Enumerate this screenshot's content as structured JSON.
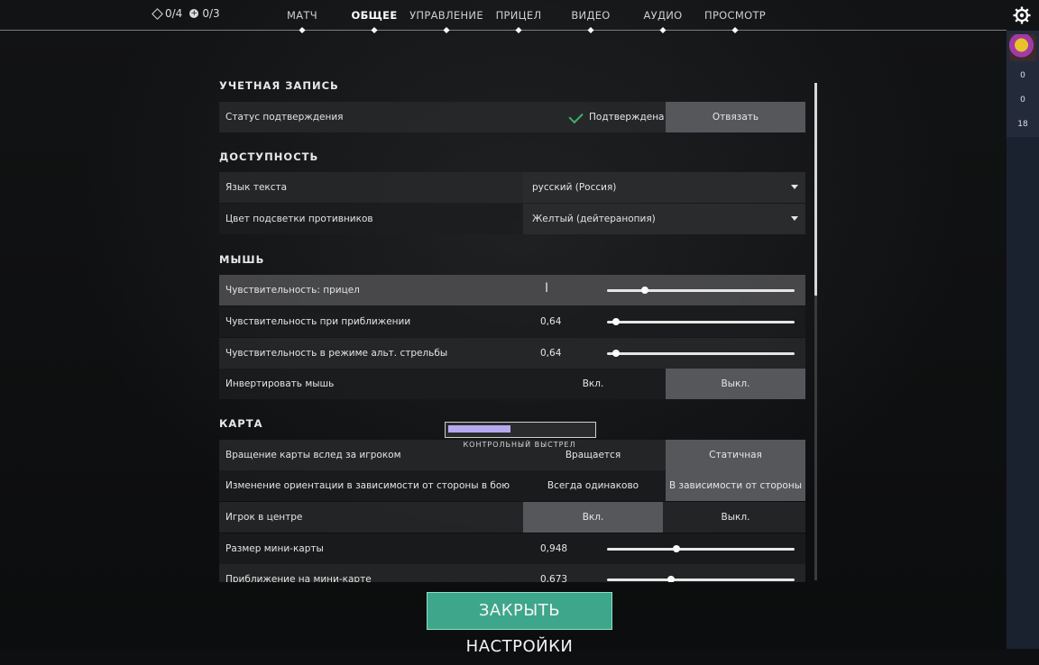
{
  "counters": [
    {
      "icon": "diamond-icon",
      "text": "0/4"
    },
    {
      "icon": "plus-circle-icon",
      "text": "0/3"
    }
  ],
  "tabs": [
    {
      "label": "МАТЧ",
      "active": false
    },
    {
      "label": "ОБЩЕЕ",
      "active": true
    },
    {
      "label": "УПРАВЛЕНИЕ",
      "active": false
    },
    {
      "label": "ПРИЦЕЛ",
      "active": false
    },
    {
      "label": "ВИДЕО",
      "active": false
    },
    {
      "label": "АУДИО",
      "active": false
    },
    {
      "label": "ПРОСМОТР",
      "active": false
    }
  ],
  "roster": {
    "values": [
      "0",
      "0",
      "18"
    ]
  },
  "sections": {
    "account": "УЧЕТНАЯ ЗАПИСЬ",
    "accessibility": "ДОСТУПНОСТЬ",
    "mouse": "МЫШЬ",
    "map": "КАРТА"
  },
  "account": {
    "status_label": "Статус подтверждения",
    "status_value": "Подтверждена",
    "unlink_label": "Отвязать"
  },
  "accessibility": {
    "language_label": "Язык текста",
    "language_value": "русский (Россия)",
    "enemy_color_label": "Цвет подсветки противников",
    "enemy_color_value": "Желтый (дейтеранопия)"
  },
  "mouse": {
    "sens_aim_label": "Чувствительность: прицел",
    "sens_aim_value": "",
    "sens_aim_level": 0.2,
    "sens_zoom_label": "Чувствительность при приближении",
    "sens_zoom_value": "0,64",
    "sens_zoom_level": 0.05,
    "sens_alt_label": "Чувствительность в режиме альт. стрельбы",
    "sens_alt_value": "0,64",
    "sens_alt_level": 0.05,
    "invert_label": "Инвертировать мышь",
    "on": "Вкл.",
    "off": "Выкл."
  },
  "map": {
    "rotate_label": "Вращение карты вслед за игроком",
    "rotate_opt_a": "Вращается",
    "rotate_opt_b": "Статичная",
    "orient_label": "Изменение ориентации в зависимости от стороны в бою",
    "orient_opt_a": "Всегда одинаково",
    "orient_opt_b": "В зависимости от стороны",
    "center_label": "Игрок в центре",
    "on": "Вкл.",
    "off": "Выкл.",
    "minimap_size_label": "Размер мини-карты",
    "minimap_size_value": "0,948",
    "minimap_size_level": 0.37,
    "minimap_zoom_label": "Приближение на мини-карте",
    "minimap_zoom_value": "0,673",
    "minimap_zoom_level": 0.34
  },
  "toast": {
    "label": "КОНТРОЛЬНЫЙ ВЫСТРЕЛ",
    "progress": 0.43
  },
  "close_button": "ЗАКРЫТЬ НАСТРОЙКИ"
}
